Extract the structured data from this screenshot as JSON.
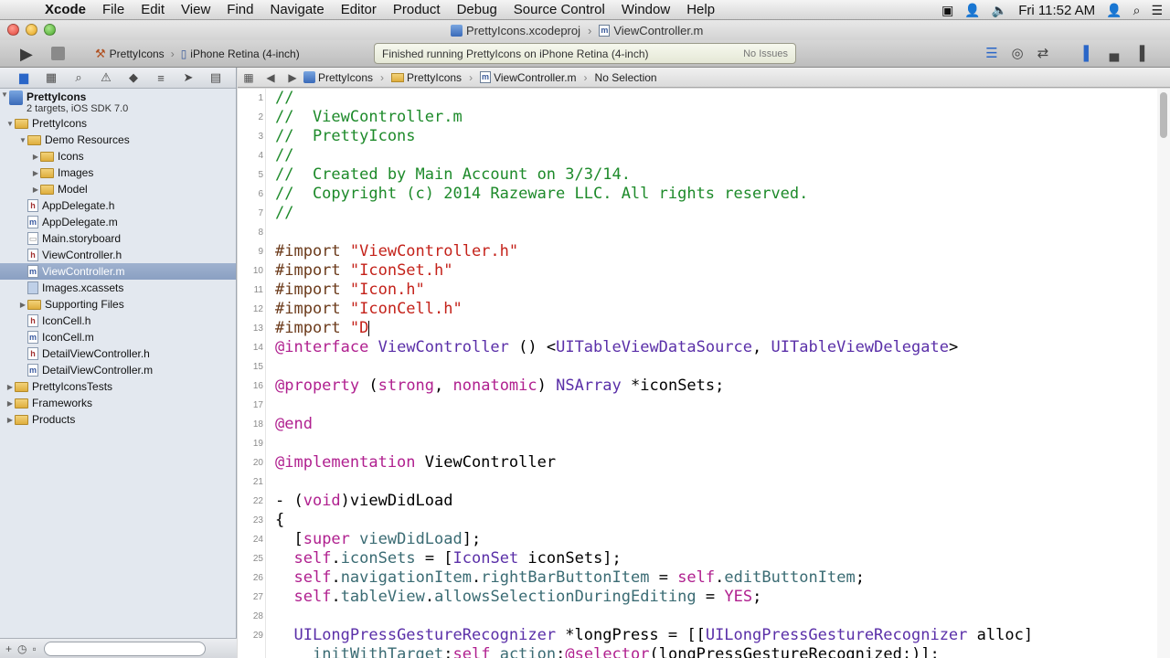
{
  "menubar": {
    "apple_glyph": "",
    "items": [
      "Xcode",
      "File",
      "Edit",
      "View",
      "Find",
      "Navigate",
      "Editor",
      "Product",
      "Debug",
      "Source Control",
      "Window",
      "Help"
    ],
    "clock": "Fri 11:52 AM"
  },
  "window": {
    "project_file": "PrettyIcons.xcodeproj",
    "current_file": "ViewController.m"
  },
  "toolbar": {
    "scheme": "PrettyIcons",
    "destination": "iPhone Retina (4-inch)",
    "activity_status": "Finished running PrettyIcons on iPhone Retina (4-inch)",
    "issues": "No Issues"
  },
  "navigator": {
    "project": {
      "name": "PrettyIcons",
      "subtitle": "2 targets, iOS SDK 7.0"
    },
    "items": [
      {
        "label": "PrettyIcons",
        "depth": 1,
        "kind": "folder",
        "disclosure": "open"
      },
      {
        "label": "Demo Resources",
        "depth": 2,
        "kind": "folder",
        "disclosure": "open"
      },
      {
        "label": "Icons",
        "depth": 3,
        "kind": "folder",
        "disclosure": "closed"
      },
      {
        "label": "Images",
        "depth": 3,
        "kind": "folder",
        "disclosure": "closed"
      },
      {
        "label": "Model",
        "depth": 3,
        "kind": "folder",
        "disclosure": "closed"
      },
      {
        "label": "AppDelegate.h",
        "depth": 2,
        "kind": "h",
        "disclosure": ""
      },
      {
        "label": "AppDelegate.m",
        "depth": 2,
        "kind": "m",
        "disclosure": ""
      },
      {
        "label": "Main.storyboard",
        "depth": 2,
        "kind": "storyboard",
        "disclosure": ""
      },
      {
        "label": "ViewController.h",
        "depth": 2,
        "kind": "h",
        "disclosure": ""
      },
      {
        "label": "ViewController.m",
        "depth": 2,
        "kind": "m",
        "disclosure": "",
        "selected": true
      },
      {
        "label": "Images.xcassets",
        "depth": 2,
        "kind": "assets",
        "disclosure": ""
      },
      {
        "label": "Supporting Files",
        "depth": 2,
        "kind": "folder",
        "disclosure": "closed"
      },
      {
        "label": "IconCell.h",
        "depth": 2,
        "kind": "h",
        "disclosure": ""
      },
      {
        "label": "IconCell.m",
        "depth": 2,
        "kind": "m",
        "disclosure": ""
      },
      {
        "label": "DetailViewController.h",
        "depth": 2,
        "kind": "h",
        "disclosure": ""
      },
      {
        "label": "DetailViewController.m",
        "depth": 2,
        "kind": "m",
        "disclosure": ""
      },
      {
        "label": "PrettyIconsTests",
        "depth": 1,
        "kind": "folder",
        "disclosure": "closed"
      },
      {
        "label": "Frameworks",
        "depth": 1,
        "kind": "folder",
        "disclosure": "closed"
      },
      {
        "label": "Products",
        "depth": 1,
        "kind": "folder",
        "disclosure": "closed"
      }
    ]
  },
  "jumpbar": {
    "crumbs": [
      "PrettyIcons",
      "PrettyIcons",
      "ViewController.m",
      "No Selection"
    ]
  },
  "editor": {
    "lines": [
      {
        "n": "1",
        "t": [
          [
            "cmt",
            "//"
          ]
        ]
      },
      {
        "n": "2",
        "t": [
          [
            "cmt",
            "//  ViewController.m"
          ]
        ]
      },
      {
        "n": "3",
        "t": [
          [
            "cmt",
            "//  PrettyIcons"
          ]
        ]
      },
      {
        "n": "4",
        "t": [
          [
            "cmt",
            "//"
          ]
        ]
      },
      {
        "n": "5",
        "t": [
          [
            "cmt",
            "//  Created by Main Account on 3/3/14."
          ]
        ]
      },
      {
        "n": "6",
        "t": [
          [
            "cmt",
            "//  Copyright (c) 2014 Razeware LLC. All rights reserved."
          ]
        ]
      },
      {
        "n": "7",
        "t": [
          [
            "cmt",
            "//"
          ]
        ]
      },
      {
        "n": "8",
        "t": []
      },
      {
        "n": "9",
        "t": [
          [
            "pp",
            "#import "
          ],
          [
            "str",
            "\"ViewController.h\""
          ]
        ]
      },
      {
        "n": "10",
        "t": [
          [
            "pp",
            "#import "
          ],
          [
            "str",
            "\"IconSet.h\""
          ]
        ]
      },
      {
        "n": "11",
        "t": [
          [
            "pp",
            "#import "
          ],
          [
            "str",
            "\"Icon.h\""
          ]
        ]
      },
      {
        "n": "12",
        "t": [
          [
            "pp",
            "#import "
          ],
          [
            "str",
            "\"IconCell.h\""
          ]
        ]
      },
      {
        "n": "13",
        "t": [
          [
            "pp",
            "#import "
          ],
          [
            "str",
            "\"D"
          ]
        ],
        "cursor": true
      },
      {
        "n": "14",
        "t": [
          [
            "kw",
            "@interface"
          ],
          [
            "",
            " "
          ],
          [
            "cls",
            "ViewController"
          ],
          [
            "",
            " () <"
          ],
          [
            "cls",
            "UITableViewDataSource"
          ],
          [
            "",
            ", "
          ],
          [
            "cls",
            "UITableViewDelegate"
          ],
          [
            "",
            ">"
          ]
        ]
      },
      {
        "n": "15",
        "t": []
      },
      {
        "n": "16",
        "t": [
          [
            "kw",
            "@property"
          ],
          [
            "",
            " ("
          ],
          [
            "kw",
            "strong"
          ],
          [
            "",
            ", "
          ],
          [
            "kw",
            "nonatomic"
          ],
          [
            "",
            ") "
          ],
          [
            "cls",
            "NSArray"
          ],
          [
            "",
            " *iconSets;"
          ]
        ]
      },
      {
        "n": "17",
        "t": []
      },
      {
        "n": "18",
        "t": [
          [
            "kw",
            "@end"
          ]
        ]
      },
      {
        "n": "19",
        "t": []
      },
      {
        "n": "20",
        "t": [
          [
            "kw",
            "@implementation"
          ],
          [
            "",
            " ViewController"
          ]
        ]
      },
      {
        "n": "21",
        "t": []
      },
      {
        "n": "22",
        "t": [
          [
            "",
            "- ("
          ],
          [
            "kw",
            "void"
          ],
          [
            "",
            ")viewDidLoad"
          ]
        ]
      },
      {
        "n": "23",
        "t": [
          [
            "",
            "{"
          ]
        ]
      },
      {
        "n": "24",
        "t": [
          [
            "",
            "  ["
          ],
          [
            "kw",
            "super"
          ],
          [
            "",
            " "
          ],
          [
            "prop",
            "viewDidLoad"
          ],
          [
            "",
            "];"
          ]
        ]
      },
      {
        "n": "25",
        "t": [
          [
            "",
            "  "
          ],
          [
            "kw",
            "self"
          ],
          [
            "",
            "."
          ],
          [
            "prop",
            "iconSets"
          ],
          [
            "",
            " = ["
          ],
          [
            "cls",
            "IconSet"
          ],
          [
            "",
            " iconSets];"
          ]
        ]
      },
      {
        "n": "26",
        "t": [
          [
            "",
            "  "
          ],
          [
            "kw",
            "self"
          ],
          [
            "",
            "."
          ],
          [
            "prop",
            "navigationItem"
          ],
          [
            "",
            "."
          ],
          [
            "prop",
            "rightBarButtonItem"
          ],
          [
            "",
            " = "
          ],
          [
            "kw",
            "self"
          ],
          [
            "",
            "."
          ],
          [
            "prop",
            "editButtonItem"
          ],
          [
            "",
            ";"
          ]
        ]
      },
      {
        "n": "27",
        "t": [
          [
            "",
            "  "
          ],
          [
            "kw",
            "self"
          ],
          [
            "",
            "."
          ],
          [
            "prop",
            "tableView"
          ],
          [
            "",
            "."
          ],
          [
            "prop",
            "allowsSelectionDuringEditing"
          ],
          [
            "",
            " = "
          ],
          [
            "kw",
            "YES"
          ],
          [
            "",
            ";"
          ]
        ]
      },
      {
        "n": "28",
        "t": []
      },
      {
        "n": "29",
        "t": [
          [
            "",
            "  "
          ],
          [
            "cls",
            "UILongPressGestureRecognizer"
          ],
          [
            "",
            " *longPress = [["
          ],
          [
            "cls",
            "UILongPressGestureRecognizer"
          ],
          [
            "",
            " alloc]"
          ]
        ]
      },
      {
        "n": "",
        "t": [
          [
            "",
            "    "
          ],
          [
            "prop",
            "initWithTarget"
          ],
          [
            "",
            ":"
          ],
          [
            "kw",
            "self"
          ],
          [
            "",
            " "
          ],
          [
            "prop",
            "action"
          ],
          [
            "",
            ":"
          ],
          [
            "kw",
            "@selector"
          ],
          [
            "",
            "(longPressGestureRecognized:)];"
          ]
        ]
      }
    ]
  }
}
